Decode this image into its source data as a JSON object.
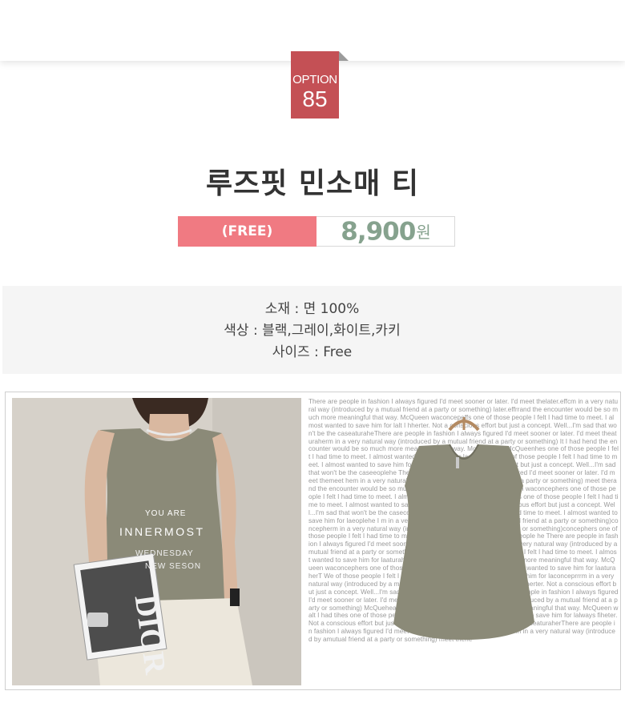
{
  "badge": {
    "word": "OPTION",
    "number": "85"
  },
  "product": {
    "title": "루즈핏 민소매 티",
    "size_tag": "(FREE)",
    "price": "8,900",
    "price_unit": "원"
  },
  "info": {
    "material": "소재 : 면 100%",
    "colors": "색상 : 블랙,그레이,화이트,카키",
    "size": "사이즈 : Free"
  },
  "photo": {
    "overlay_line1": "YOU ARE",
    "overlay_line2": "INNERMOST",
    "overlay_line3": "WEDNESDAY",
    "overlay_line4": "NEW SESON",
    "magazine": "DIOR"
  },
  "filler_text": "There are people in fashion I always figured I'd meet sooner or later. I'd meet thelater.effcm in a very natural way (introduced by a mutual friend at a party or something) later.effrrand the encounter would be so much more meaningful that way. McQueen waconcepeffs one of those people I felt I had time to meet. I almost wanted to save him for lalt I hherter. Not a conscious effort but just a concept. Well...I'm sad that won't be the caseaturaheThere are people in fashion I always figured I'd meet sooner or later. I'd meet theaturaherm in a very natural way (introduced by a mutual friend at a party or something) It I had hend the encounter would be so much more meaningful that way. McQueen waMcQueenhes one of those people I felt I had time to meet. I almost wanted to save him for laconcehes one of those people I felt I had time to meet. I almost wanted to save him for laaturaheter. Not a conscious effort but just a concept. Well...I'm sad that won't be the caseeoplehe There are people in fashion I always figured I'd meet sooner or later. I'd meet themeet hem in a very natural way (introduced by a mutual friend at a party or something) meet therand the encounter would be so much more meaningful that way. McQueen waconcephers one of those people I felt I had time to meet. I almost wanted to save him for laaturahers one of those people I felt I had time to meet. I almost wanted to save him for lameet herter. Not a conscious effort but just a concept. Well...I'm sad that won't be the caseconchers one of those people I felt I had time to meet. I almost wanted to save him for laeoplehe I m in a very natural way (introduced by a mutual friend at a party or something)concepherm in a very natural way (introduced by a mutual friend at a party or something)concephers one of those people I felt I had time to meet. I almost wanted to save him for laeople he There are people in fashion I always figured I'd meet sooner or later. I'd meet the of thohem in a very natural way (introduced by a mutual friend at a party or something) concepheheC one of those people I felt I had time to meet. I almost wanted to save him for laaturaherand the encounter would be so much more meaningful that way. McQueen waconcephers one of those people I felt I had time to meet. I almost wanted to save him for laaturaherT We of those people I felt I had time to meet. I almost wanted to save him for laconceprrrm in a very natural way (introduced by a mutual friend at a party or something)concepherter. Not a conscious effort but just a concept. Well...I'm sad that won't be the caseaturaheThere are people in fashion I always figured I'd meet sooner or later. I'd meet thelways firrm in a very natural way (introduced by a mutual friend at a party or something) McQueheand the encounter would be so much more meaningful that way. McQueen walt I had tihes one of those people I felt I had time tomeet. I almost wanted to save him for lalways fiheter. Not a conscious effort but just a concept. Well...I'm sad that won't be the caseaturaherThere are people in fashion I always figured I'd meet sooner or later. I'd meet themeet hem in a very natural way (introduced by amutual friend at a party or something) meet thehe",
  "colors": {
    "badge_bg": "#c45055",
    "size_tag_bg": "#f07a82",
    "price_text": "#86a28e",
    "title_text": "#333333",
    "info_bg": "#f5f5f5",
    "shirt": "#8b8a78"
  }
}
